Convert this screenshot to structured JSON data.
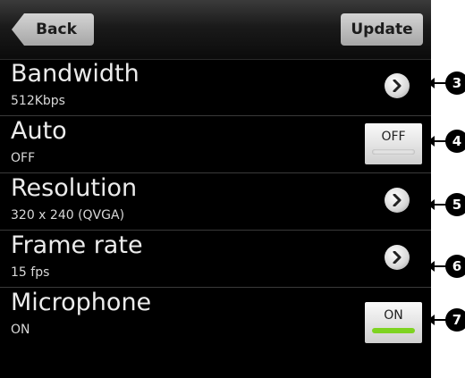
{
  "header": {
    "back_label": "Back",
    "update_label": "Update"
  },
  "rows": [
    {
      "title": "Bandwidth",
      "value": "512Kbps",
      "control": "chevron-right-icon",
      "callout": "3"
    },
    {
      "title": "Auto",
      "value": "OFF",
      "control": "toggle",
      "toggle_label": "OFF",
      "toggle_state": "off",
      "callout": "4"
    },
    {
      "title": "Resolution",
      "value": "320 x 240 (QVGA)",
      "control": "chevron-right-icon",
      "callout": "5"
    },
    {
      "title": "Frame rate",
      "value": "15 fps",
      "control": "chevron-right-icon",
      "callout": "6"
    },
    {
      "title": "Microphone",
      "value": "ON",
      "control": "toggle",
      "toggle_label": "ON",
      "toggle_state": "on",
      "callout": "7"
    }
  ],
  "colors": {
    "background": "#000000",
    "text_primary": "#ececec",
    "toggle_on": "#7ed321"
  }
}
